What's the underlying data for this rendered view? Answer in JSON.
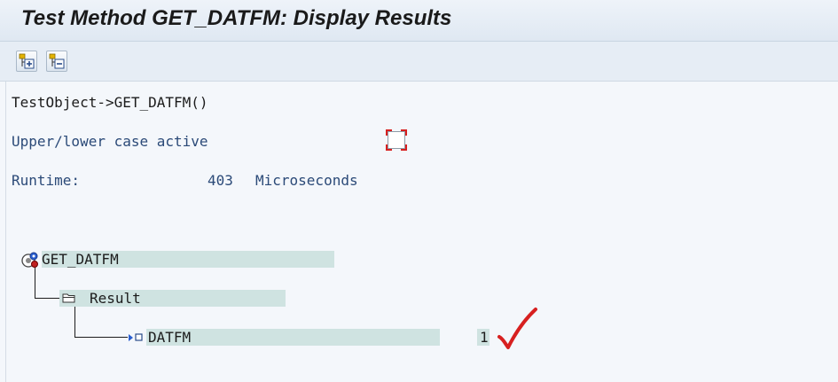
{
  "window": {
    "title": "Test Method GET_DATFM: Display Results"
  },
  "toolbar": {
    "buttons": [
      {
        "name": "expand-all-button",
        "icon": "expand-tree-icon"
      },
      {
        "name": "collapse-all-button",
        "icon": "collapse-tree-icon"
      }
    ]
  },
  "info": {
    "call": "TestObject->GET_DATFM()",
    "case_label": "Upper/lower case active",
    "case_checked": false,
    "runtime_label": "Runtime:",
    "runtime_value": "403",
    "runtime_unit": "Microseconds"
  },
  "tree": {
    "root": {
      "label": "GET_DATFM",
      "icon": "method-gear-icon"
    },
    "child": {
      "label": "Result",
      "icon": "folder-icon"
    },
    "leaf": {
      "label": "DATFM",
      "value": "1",
      "icon": "parameter-out-icon"
    }
  },
  "colors": {
    "accent_red": "#d72020",
    "tree_highlight": "#cfe3e1",
    "text_blue": "#2b4a78"
  }
}
